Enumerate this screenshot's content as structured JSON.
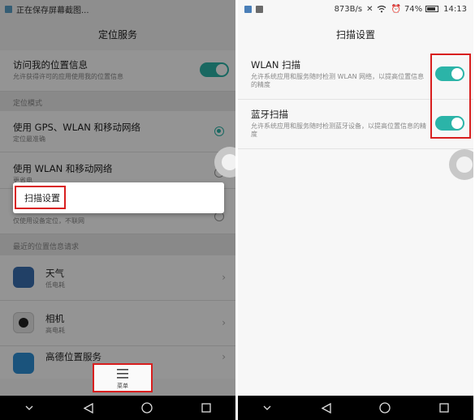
{
  "left": {
    "status_text": "正在保存屏幕截图...",
    "title": "定位服务",
    "access_location": {
      "title": "访问我的位置信息",
      "subtitle": "允许获得许可的应用使用我的位置信息"
    },
    "mode_section": "定位模式",
    "modes": [
      {
        "title": "使用 GPS、WLAN 和移动网络",
        "subtitle": "定位最准确"
      },
      {
        "title": "使用 WLAN 和移动网络",
        "subtitle": "更省电"
      }
    ],
    "device_only_subtitle": "仅使用设备定位，不联网",
    "popup_item": "扫描设置",
    "recent_section": "最近的位置信息请求",
    "apps": [
      {
        "name": "天气",
        "usage": "低电耗"
      },
      {
        "name": "相机",
        "usage": "高电耗"
      },
      {
        "name": "高德位置服务"
      }
    ],
    "menu_label": "菜单"
  },
  "right": {
    "status": {
      "speed": "873B/s",
      "battery": "74%",
      "time": "14:13"
    },
    "title": "扫描设置",
    "items": [
      {
        "title": "WLAN 扫描",
        "subtitle": "允许系统应用和服务随时检测 WLAN 网络，以提高位置信息的精度"
      },
      {
        "title": "蓝牙扫描",
        "subtitle": "允许系统应用和服务随时检测蓝牙设备，以提高位置信息的精度"
      }
    ]
  },
  "colors": {
    "accent": "#2bb4a8",
    "highlight": "#d81e1e"
  }
}
